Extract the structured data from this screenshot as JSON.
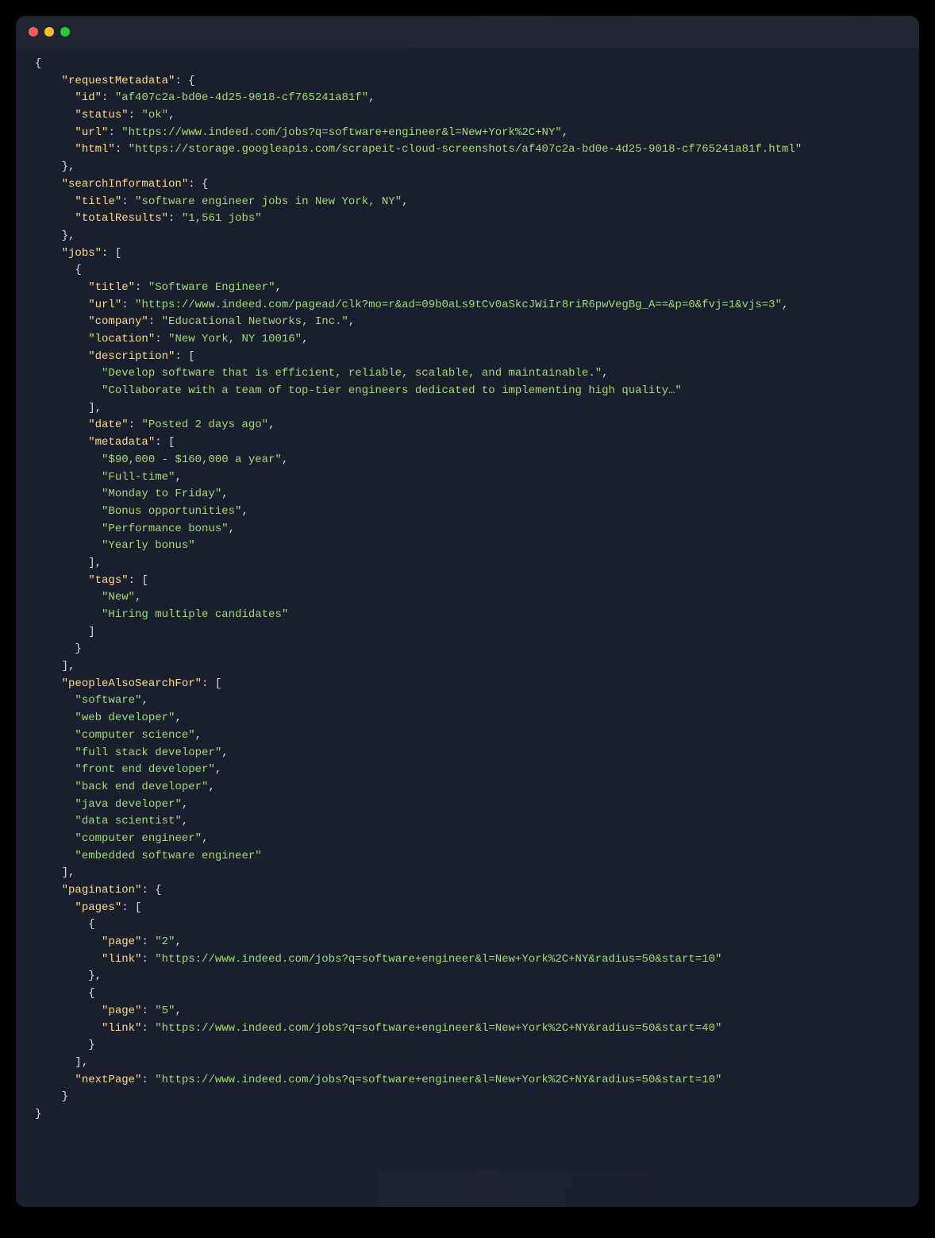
{
  "json": {
    "requestMetadata": {
      "id": "af407c2a-bd0e-4d25-9018-cf765241a81f",
      "status": "ok",
      "url": "https://www.indeed.com/jobs?q=software+engineer&l=New+York%2C+NY",
      "html": "https://storage.googleapis.com/scrapeit-cloud-screenshots/af407c2a-bd0e-4d25-9018-cf765241a81f.html"
    },
    "searchInformation": {
      "title": "software engineer jobs in New York, NY",
      "totalResults": "1,561 jobs"
    },
    "jobs": [
      {
        "title": "Software Engineer",
        "url": "https://www.indeed.com/pagead/clk?mo=r&ad=09b0aLs9tCv0aSkcJWiIr8riR6pwVegBg_A==&p=0&fvj=1&vjs=3",
        "company": "Educational Networks, Inc.",
        "location": "New York, NY 10016",
        "description": [
          "Develop software that is efficient, reliable, scalable, and maintainable.",
          "Collaborate with a team of top-tier engineers dedicated to implementing high quality…"
        ],
        "date": "Posted 2 days ago",
        "metadata": [
          "$90,000 - $160,000 a year",
          "Full-time",
          "Monday to Friday",
          "Bonus opportunities",
          "Performance bonus",
          "Yearly bonus"
        ],
        "tags": [
          "New",
          "Hiring multiple candidates"
        ]
      }
    ],
    "peopleAlsoSearchFor": [
      "software",
      "web developer",
      "computer science",
      "full stack developer",
      "front end developer",
      "back end developer",
      "java developer",
      "data scientist",
      "computer engineer",
      "embedded software engineer"
    ],
    "pagination": {
      "pages": [
        {
          "page": "2",
          "link": "https://www.indeed.com/jobs?q=software+engineer&l=New+York%2C+NY&radius=50&start=10"
        },
        {
          "page": "5",
          "link": "https://www.indeed.com/jobs?q=software+engineer&l=New+York%2C+NY&radius=50&start=40"
        }
      ],
      "nextPage": "https://www.indeed.com/jobs?q=software+engineer&l=New+York%2C+NY&radius=50&start=10"
    }
  }
}
